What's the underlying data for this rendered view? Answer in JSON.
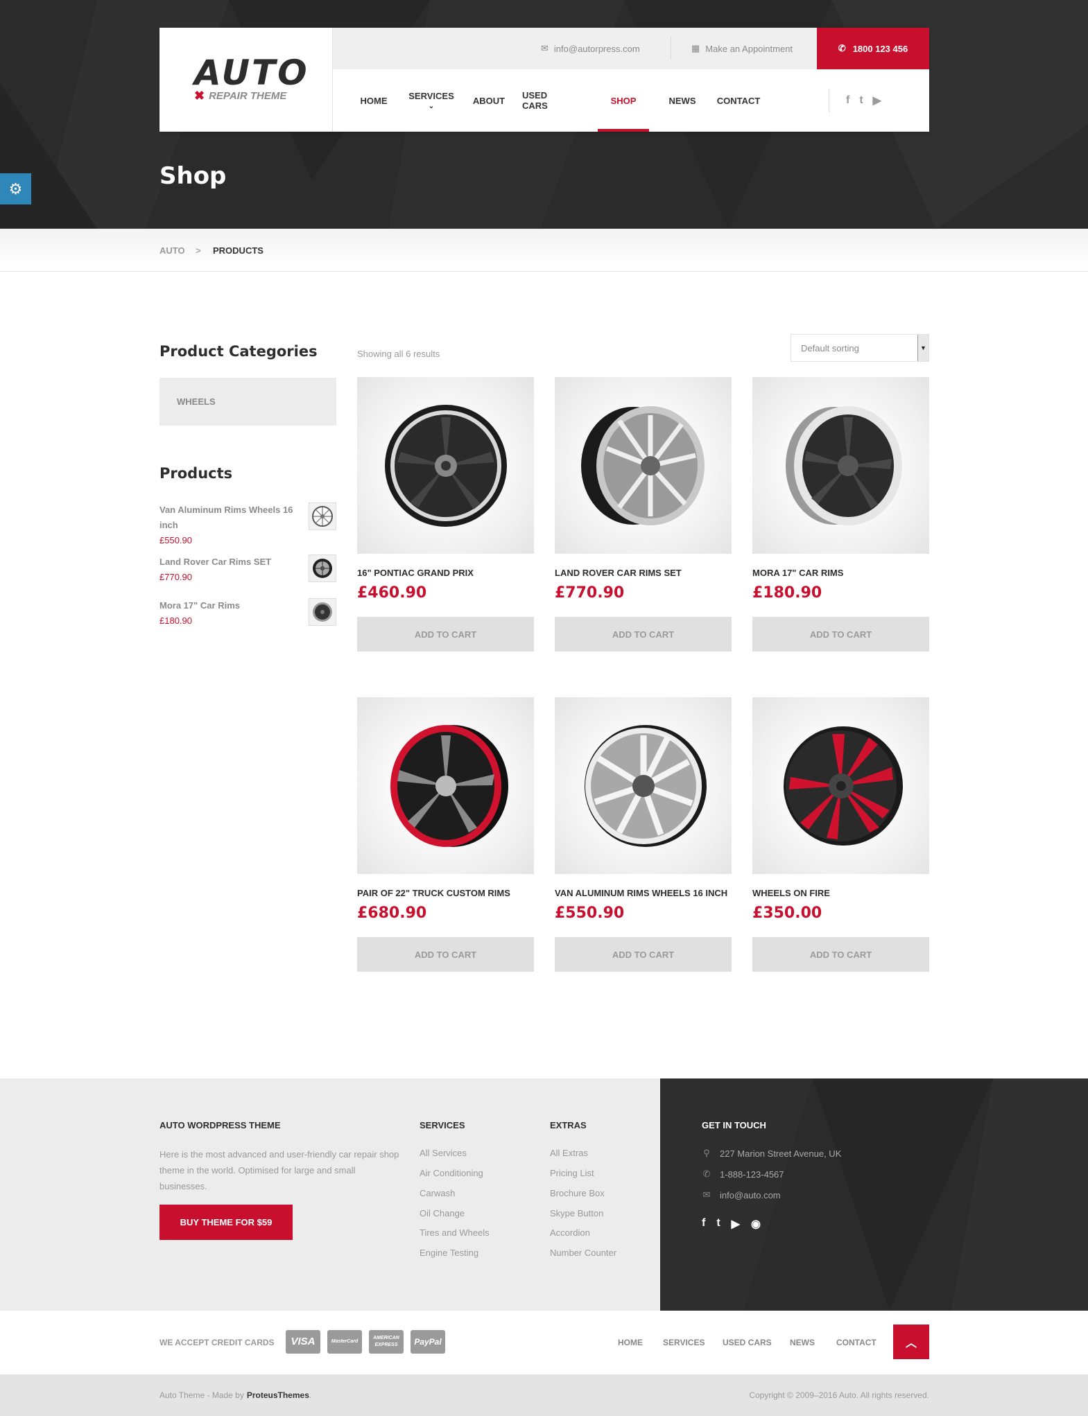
{
  "colors": {
    "accent": "#c8102e",
    "dark": "#2b2b2b",
    "light_gray": "#ececec",
    "settings_blue": "#2f86b8"
  },
  "logo": {
    "main": "AUTO",
    "sub": "REPAIR THEME"
  },
  "topbar": {
    "email": "info@autorpress.com",
    "appointment": "Make an Appointment",
    "phone": "1800 123 456"
  },
  "nav": {
    "items": [
      {
        "label": "HOME",
        "active": false
      },
      {
        "label": "SERVICES",
        "active": false,
        "has_dropdown": true
      },
      {
        "label": "ABOUT",
        "active": false
      },
      {
        "label": "USED CARS",
        "active": false
      },
      {
        "label": "SHOP",
        "active": true
      },
      {
        "label": "NEWS",
        "active": false
      },
      {
        "label": "CONTACT",
        "active": false
      }
    ],
    "social_icons": [
      "facebook-icon",
      "twitter-icon",
      "youtube-icon"
    ]
  },
  "page_title": "Shop",
  "breadcrumbs": {
    "home": "AUTO",
    "separator": ">",
    "current": "PRODUCTS"
  },
  "sidebar": {
    "categories_heading": "Product Categories",
    "categories": [
      "WHEELS"
    ],
    "products_heading": "Products",
    "products": [
      {
        "name": "Van Aluminum Rims Wheels 16 inch",
        "price": "£550.90"
      },
      {
        "name": "Land Rover Car Rims SET",
        "price": "£770.90"
      },
      {
        "name": "Mora 17\" Car Rims",
        "price": "£180.90"
      }
    ]
  },
  "shop": {
    "results_text": "Showing all 6 results",
    "sort_selected": "Default sorting",
    "add_to_cart": "ADD TO CART",
    "products": [
      {
        "name": "16\" Pontiac Grand Prix",
        "price": "£460.90"
      },
      {
        "name": "Land Rover Car Rims SET",
        "price": "£770.90"
      },
      {
        "name": "Mora 17\" Car Rims",
        "price": "£180.90"
      },
      {
        "name": "Pair of 22\" Truck Custom Rims",
        "price": "£680.90"
      },
      {
        "name": "Van Aluminum Rims Wheels 16 inch",
        "price": "£550.90"
      },
      {
        "name": "Wheels on Fire",
        "price": "£350.00"
      }
    ]
  },
  "footer": {
    "about": {
      "heading": "AUTO WORDPRESS THEME",
      "text": "Here is the most advanced and user-friendly car repair shop theme in the world. Optimised for large and small businesses.",
      "button": "BUY THEME FOR $59"
    },
    "services": {
      "heading": "SERVICES",
      "links": [
        "All Services",
        "Air Conditioning",
        "Carwash",
        "Oil Change",
        "Tires and Wheels",
        "Engine Testing"
      ]
    },
    "extras": {
      "heading": "EXTRAS",
      "links": [
        "All Extras",
        "Pricing List",
        "Brochure Box",
        "Skype Button",
        "Accordion",
        "Number Counter"
      ]
    },
    "contact": {
      "heading": "GET IN TOUCH",
      "address": "227 Marion Street Avenue, UK",
      "phone": "1-888-123-4567",
      "email": "info@auto.com",
      "social_icons": [
        "facebook-icon",
        "twitter-icon",
        "youtube-icon",
        "github-icon"
      ]
    },
    "credit_cards_label": "WE ACCEPT CREDIT CARDS",
    "cards": [
      "VISA",
      "MasterCard",
      "AMERICAN EXPRESS",
      "PayPal"
    ],
    "bottom_nav": [
      "HOME",
      "SERVICES",
      "USED CARS",
      "NEWS",
      "CONTACT"
    ],
    "credit_text": "Auto Theme - Made by",
    "credit_link": "ProteusThemes",
    "copyright": "Copyright © 2009–2016 Auto. All rights reserved."
  }
}
